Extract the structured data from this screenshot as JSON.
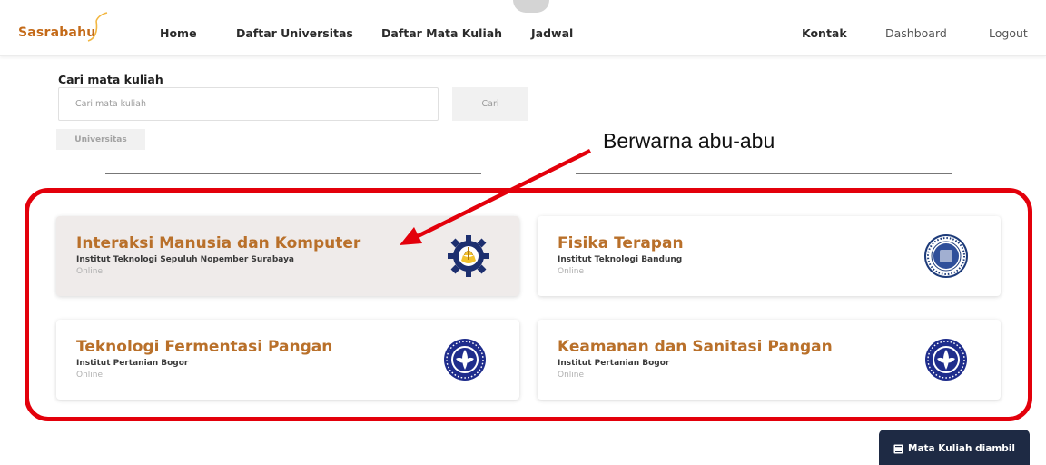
{
  "navbar": {
    "brand": "Sasrabahu",
    "items": [
      {
        "label": "Home"
      },
      {
        "label": "Daftar Universitas"
      },
      {
        "label": "Daftar Mata Kuliah"
      },
      {
        "label": "Jadwal"
      },
      {
        "label": "Kontak"
      },
      {
        "label": "Dashboard"
      },
      {
        "label": "Logout"
      }
    ]
  },
  "search": {
    "heading": "Cari mata kuliah",
    "placeholder": "Cari mata kuliah",
    "button_label": "Cari",
    "filter_label": "Universitas"
  },
  "courses": [
    {
      "title": "Interaksi Manusia dan Komputer",
      "institution": "Institut Teknologi Sepuluh Nopember Surabaya",
      "mode": "Online",
      "logo_icon": "its-logo-icon",
      "highlighted": true
    },
    {
      "title": "Fisika Terapan",
      "institution": "Institut Teknologi Bandung",
      "mode": "Online",
      "logo_icon": "itb-logo-icon",
      "highlighted": false
    },
    {
      "title": "Teknologi Fermentasi Pangan",
      "institution": "Institut Pertanian Bogor",
      "mode": "Online",
      "logo_icon": "ipb-logo-icon",
      "highlighted": false
    },
    {
      "title": "Keamanan dan Sanitasi Pangan",
      "institution": "Institut Pertanian Bogor",
      "mode": "Online",
      "logo_icon": "ipb-logo-icon",
      "highlighted": false
    }
  ],
  "annotation": {
    "text": "Berwarna abu-abu"
  },
  "floating_button": {
    "label": "Mata Kuliah diambil",
    "icon": "book-icon"
  },
  "colors": {
    "brand": "#c46a18",
    "course_title": "#b9702a",
    "highlighted_card": "#efebea",
    "annotation_red": "#e3000b",
    "floating_button": "#1e2a44"
  }
}
